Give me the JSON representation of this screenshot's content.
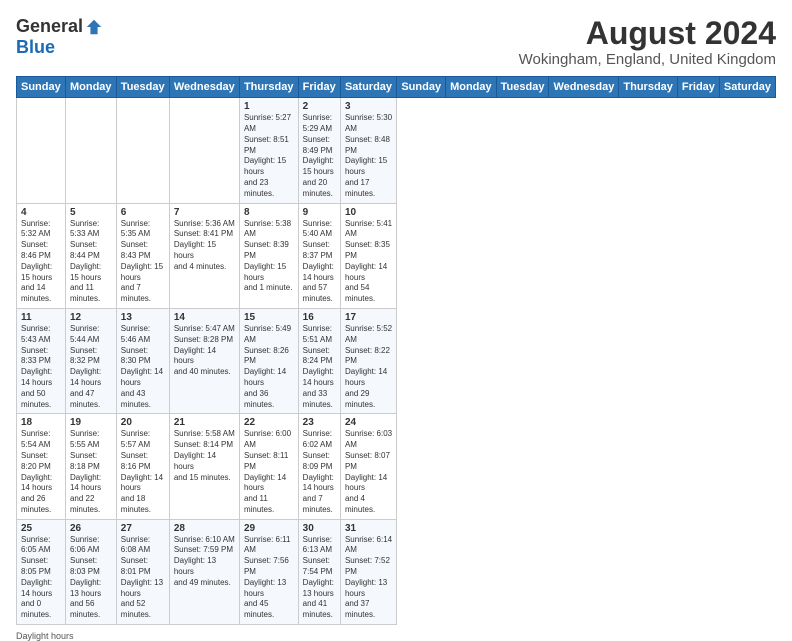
{
  "logo": {
    "general": "General",
    "blue": "Blue"
  },
  "title": {
    "month_year": "August 2024",
    "location": "Wokingham, England, United Kingdom"
  },
  "days_of_week": [
    "Sunday",
    "Monday",
    "Tuesday",
    "Wednesday",
    "Thursday",
    "Friday",
    "Saturday"
  ],
  "footer": {
    "daylight_label": "Daylight hours"
  },
  "weeks": [
    [
      {
        "num": "",
        "info": ""
      },
      {
        "num": "",
        "info": ""
      },
      {
        "num": "",
        "info": ""
      },
      {
        "num": "",
        "info": ""
      },
      {
        "num": "1",
        "info": "Sunrise: 5:27 AM\nSunset: 8:51 PM\nDaylight: 15 hours\nand 23 minutes."
      },
      {
        "num": "2",
        "info": "Sunrise: 5:29 AM\nSunset: 8:49 PM\nDaylight: 15 hours\nand 20 minutes."
      },
      {
        "num": "3",
        "info": "Sunrise: 5:30 AM\nSunset: 8:48 PM\nDaylight: 15 hours\nand 17 minutes."
      }
    ],
    [
      {
        "num": "4",
        "info": "Sunrise: 5:32 AM\nSunset: 8:46 PM\nDaylight: 15 hours\nand 14 minutes."
      },
      {
        "num": "5",
        "info": "Sunrise: 5:33 AM\nSunset: 8:44 PM\nDaylight: 15 hours\nand 11 minutes."
      },
      {
        "num": "6",
        "info": "Sunrise: 5:35 AM\nSunset: 8:43 PM\nDaylight: 15 hours\nand 7 minutes."
      },
      {
        "num": "7",
        "info": "Sunrise: 5:36 AM\nSunset: 8:41 PM\nDaylight: 15 hours\nand 4 minutes."
      },
      {
        "num": "8",
        "info": "Sunrise: 5:38 AM\nSunset: 8:39 PM\nDaylight: 15 hours\nand 1 minute."
      },
      {
        "num": "9",
        "info": "Sunrise: 5:40 AM\nSunset: 8:37 PM\nDaylight: 14 hours\nand 57 minutes."
      },
      {
        "num": "10",
        "info": "Sunrise: 5:41 AM\nSunset: 8:35 PM\nDaylight: 14 hours\nand 54 minutes."
      }
    ],
    [
      {
        "num": "11",
        "info": "Sunrise: 5:43 AM\nSunset: 8:33 PM\nDaylight: 14 hours\nand 50 minutes."
      },
      {
        "num": "12",
        "info": "Sunrise: 5:44 AM\nSunset: 8:32 PM\nDaylight: 14 hours\nand 47 minutes."
      },
      {
        "num": "13",
        "info": "Sunrise: 5:46 AM\nSunset: 8:30 PM\nDaylight: 14 hours\nand 43 minutes."
      },
      {
        "num": "14",
        "info": "Sunrise: 5:47 AM\nSunset: 8:28 PM\nDaylight: 14 hours\nand 40 minutes."
      },
      {
        "num": "15",
        "info": "Sunrise: 5:49 AM\nSunset: 8:26 PM\nDaylight: 14 hours\nand 36 minutes."
      },
      {
        "num": "16",
        "info": "Sunrise: 5:51 AM\nSunset: 8:24 PM\nDaylight: 14 hours\nand 33 minutes."
      },
      {
        "num": "17",
        "info": "Sunrise: 5:52 AM\nSunset: 8:22 PM\nDaylight: 14 hours\nand 29 minutes."
      }
    ],
    [
      {
        "num": "18",
        "info": "Sunrise: 5:54 AM\nSunset: 8:20 PM\nDaylight: 14 hours\nand 26 minutes."
      },
      {
        "num": "19",
        "info": "Sunrise: 5:55 AM\nSunset: 8:18 PM\nDaylight: 14 hours\nand 22 minutes."
      },
      {
        "num": "20",
        "info": "Sunrise: 5:57 AM\nSunset: 8:16 PM\nDaylight: 14 hours\nand 18 minutes."
      },
      {
        "num": "21",
        "info": "Sunrise: 5:58 AM\nSunset: 8:14 PM\nDaylight: 14 hours\nand 15 minutes."
      },
      {
        "num": "22",
        "info": "Sunrise: 6:00 AM\nSunset: 8:11 PM\nDaylight: 14 hours\nand 11 minutes."
      },
      {
        "num": "23",
        "info": "Sunrise: 6:02 AM\nSunset: 8:09 PM\nDaylight: 14 hours\nand 7 minutes."
      },
      {
        "num": "24",
        "info": "Sunrise: 6:03 AM\nSunset: 8:07 PM\nDaylight: 14 hours\nand 4 minutes."
      }
    ],
    [
      {
        "num": "25",
        "info": "Sunrise: 6:05 AM\nSunset: 8:05 PM\nDaylight: 14 hours\nand 0 minutes."
      },
      {
        "num": "26",
        "info": "Sunrise: 6:06 AM\nSunset: 8:03 PM\nDaylight: 13 hours\nand 56 minutes."
      },
      {
        "num": "27",
        "info": "Sunrise: 6:08 AM\nSunset: 8:01 PM\nDaylight: 13 hours\nand 52 minutes."
      },
      {
        "num": "28",
        "info": "Sunrise: 6:10 AM\nSunset: 7:59 PM\nDaylight: 13 hours\nand 49 minutes."
      },
      {
        "num": "29",
        "info": "Sunrise: 6:11 AM\nSunset: 7:56 PM\nDaylight: 13 hours\nand 45 minutes."
      },
      {
        "num": "30",
        "info": "Sunrise: 6:13 AM\nSunset: 7:54 PM\nDaylight: 13 hours\nand 41 minutes."
      },
      {
        "num": "31",
        "info": "Sunrise: 6:14 AM\nSunset: 7:52 PM\nDaylight: 13 hours\nand 37 minutes."
      }
    ]
  ]
}
